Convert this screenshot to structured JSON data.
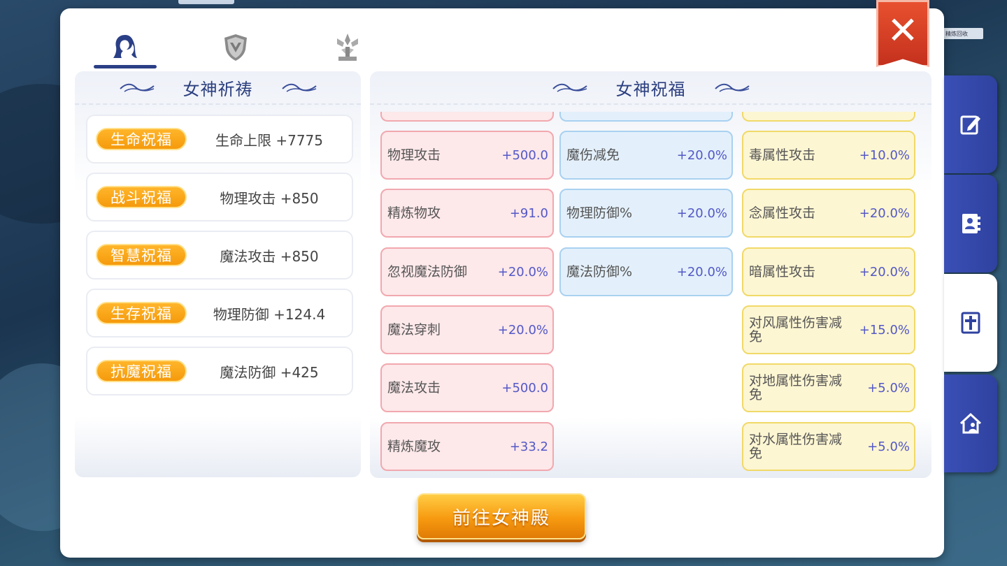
{
  "background": {
    "top_label": "",
    "right_label": "精炼回收"
  },
  "tabs": [
    {
      "name": "goddess-icon"
    },
    {
      "name": "shield-icon"
    },
    {
      "name": "crystal-icon"
    }
  ],
  "side_tabs": [
    "edit-icon",
    "contact-book-icon",
    "cross-icon",
    "home-icon"
  ],
  "prayer": {
    "title": "女神祈祷",
    "rows": [
      {
        "badge": "生命祝福",
        "value": "生命上限 +7775"
      },
      {
        "badge": "战斗祝福",
        "value": "物理攻击 +850"
      },
      {
        "badge": "智慧祝福",
        "value": "魔法攻击 +850"
      },
      {
        "badge": "生存祝福",
        "value": "物理防御 +124.4"
      },
      {
        "badge": "抗魔祝福",
        "value": "魔法防御 +425"
      }
    ]
  },
  "blessing": {
    "title": "女神祝福",
    "col1": [
      {
        "label": "物理攻击",
        "value": "+500.0"
      },
      {
        "label": "精炼物攻",
        "value": "+91.0"
      },
      {
        "label": "忽视魔法防御",
        "value": "+20.0%"
      },
      {
        "label": "魔法穿刺",
        "value": "+20.0%"
      },
      {
        "label": "魔法攻击",
        "value": "+500.0"
      },
      {
        "label": "精炼魔攻",
        "value": "+33.2"
      }
    ],
    "col2": [
      {
        "label": "魔伤减免",
        "value": "+20.0%"
      },
      {
        "label": "物理防御%",
        "value": "+20.0%"
      },
      {
        "label": "魔法防御%",
        "value": "+20.0%"
      }
    ],
    "col3": [
      {
        "label": "毒属性攻击",
        "value": "+10.0%"
      },
      {
        "label": "念属性攻击",
        "value": "+20.0%"
      },
      {
        "label": "暗属性攻击",
        "value": "+20.0%"
      },
      {
        "label": "对风属性伤害减免",
        "value": "+15.0%"
      },
      {
        "label": "对地属性伤害减免",
        "value": "+5.0%"
      },
      {
        "label": "对水属性伤害减免",
        "value": "+5.0%"
      }
    ]
  },
  "go_button": "前往女神殿",
  "close": "✕",
  "colors": {
    "accent": "#2a3f86",
    "orange": "#f59a0c",
    "close": "#d8401f"
  }
}
